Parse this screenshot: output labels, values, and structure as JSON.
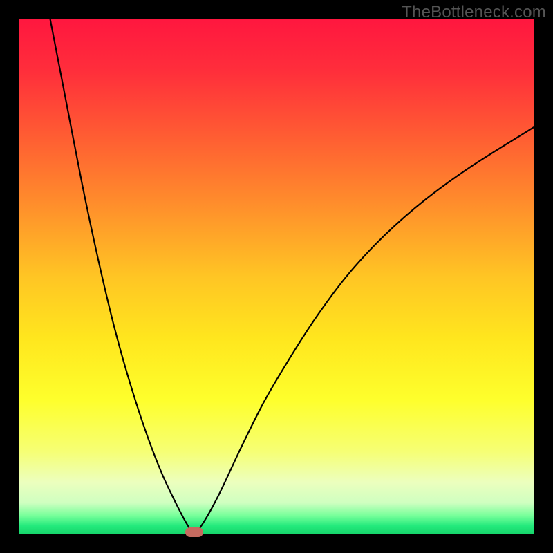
{
  "watermark": "TheBottleneck.com",
  "colors": {
    "frame_bg": "#000000",
    "curve": "#000000",
    "marker": "#c56a5f",
    "watermark": "#555555",
    "gradient_stops": [
      {
        "offset": 0.0,
        "color": "#ff173f"
      },
      {
        "offset": 0.1,
        "color": "#ff2e3b"
      },
      {
        "offset": 0.22,
        "color": "#ff5a33"
      },
      {
        "offset": 0.35,
        "color": "#ff8a2c"
      },
      {
        "offset": 0.5,
        "color": "#ffc524"
      },
      {
        "offset": 0.62,
        "color": "#ffe61e"
      },
      {
        "offset": 0.74,
        "color": "#feff2c"
      },
      {
        "offset": 0.84,
        "color": "#f6ff74"
      },
      {
        "offset": 0.9,
        "color": "#ecffbe"
      },
      {
        "offset": 0.94,
        "color": "#cfffc0"
      },
      {
        "offset": 0.965,
        "color": "#77ff9a"
      },
      {
        "offset": 0.985,
        "color": "#23ea7c"
      },
      {
        "offset": 1.0,
        "color": "#17d66c"
      }
    ]
  },
  "chart_data": {
    "type": "line",
    "title": "",
    "xlabel": "",
    "ylabel": "",
    "xlim": [
      0,
      100
    ],
    "ylim": [
      0,
      100
    ],
    "grid": false,
    "legend": false,
    "minimum_marker": {
      "x": 34.0,
      "y": 0.0
    },
    "series": [
      {
        "name": "left-branch",
        "x": [
          6.0,
          9.1,
          12.2,
          15.4,
          18.5,
          21.6,
          24.7,
          27.8,
          30.9,
          32.8,
          34.0
        ],
        "y": [
          100.0,
          84.0,
          68.0,
          53.0,
          40.0,
          29.0,
          19.5,
          11.5,
          5.0,
          1.5,
          0.0
        ]
      },
      {
        "name": "right-branch",
        "x": [
          34.0,
          36.0,
          39.0,
          43.0,
          47.5,
          52.5,
          58.0,
          64.0,
          71.0,
          79.0,
          88.0,
          100.0
        ],
        "y": [
          0.0,
          2.5,
          8.0,
          16.5,
          25.5,
          34.0,
          42.5,
          50.5,
          58.0,
          65.0,
          71.5,
          79.0
        ]
      }
    ]
  }
}
